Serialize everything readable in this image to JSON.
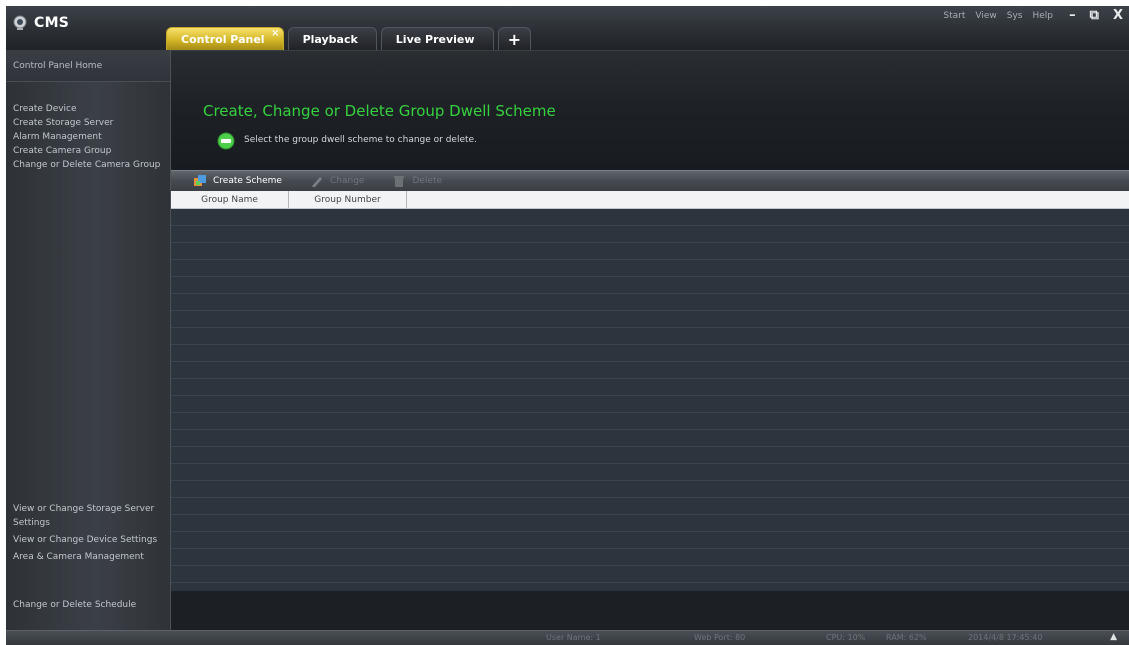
{
  "app": {
    "title": "CMS"
  },
  "tabs": [
    {
      "label": "Control Panel",
      "close": "×"
    },
    {
      "label": "Playback"
    },
    {
      "label": "Live Preview"
    },
    {
      "label": "+"
    }
  ],
  "top_menu": [
    "Start",
    "View",
    "Sys",
    "Help"
  ],
  "window_controls": {
    "minimize": "–",
    "restore": "⧉",
    "close": "X"
  },
  "sidebar": {
    "home": "Control Panel Home",
    "top_items": [
      "Create Device",
      "Create Storage Server",
      "Alarm Management",
      "Create Camera Group",
      "Change or Delete Camera Group"
    ],
    "bottom_items": [
      "View or Change Storage Server Settings",
      "View or Change Device Settings",
      "Area & Camera Management"
    ],
    "schedule_item": "Change or Delete Schedule"
  },
  "main": {
    "title": "Create, Change or Delete Group Dwell Scheme",
    "subtitle": "Select the group dwell scheme to change or delete.",
    "toolbar": {
      "create": "Create Scheme",
      "change": "Change",
      "delete": "Delete"
    },
    "table": {
      "columns": [
        "Group Name",
        "Group Number"
      ],
      "rows": []
    }
  },
  "status": {
    "user": "User Name: 1",
    "port": "Web Port: 80",
    "cpu": "CPU: 10%",
    "ram": "RAM: 62%",
    "time": "2014/4/8 17:45:40"
  },
  "colors": {
    "accent_tab": "#d4b628",
    "title_green": "#35d23e",
    "background": "#1f2327"
  },
  "icons": {
    "logo": "camera-logo-icon",
    "info": "info-circle-icon",
    "create": "create-scheme-icon",
    "change": "pencil-icon",
    "delete": "trash-icon"
  }
}
